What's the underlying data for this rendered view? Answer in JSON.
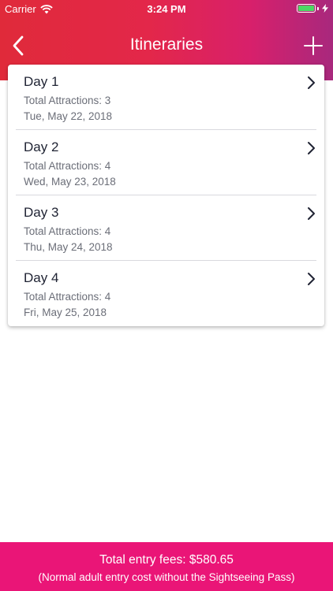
{
  "status_bar": {
    "carrier": "Carrier",
    "time": "3:24 PM",
    "battery_level": 1.0,
    "battery_color": "#4cd964"
  },
  "nav": {
    "title": "Itineraries",
    "back_icon": "chevron-left-icon",
    "add_icon": "plus-icon"
  },
  "days": [
    {
      "title": "Day 1",
      "attractions": "Total Attractions: 3",
      "date": "Tue, May 22, 2018"
    },
    {
      "title": "Day 2",
      "attractions": "Total Attractions: 4",
      "date": "Wed, May 23, 2018"
    },
    {
      "title": "Day 3",
      "attractions": "Total Attractions: 4",
      "date": "Thu, May 24, 2018"
    },
    {
      "title": "Day 4",
      "attractions": "Total Attractions: 4",
      "date": "Fri, May 25, 2018"
    }
  ],
  "footer": {
    "total": "Total entry fees: $580.65",
    "note": "(Normal adult entry cost without the Sightseeing Pass)"
  },
  "colors": {
    "header_gradient_start": "#e02a3a",
    "header_gradient_end": "#a8287d",
    "footer_bg": "#ea1577"
  }
}
